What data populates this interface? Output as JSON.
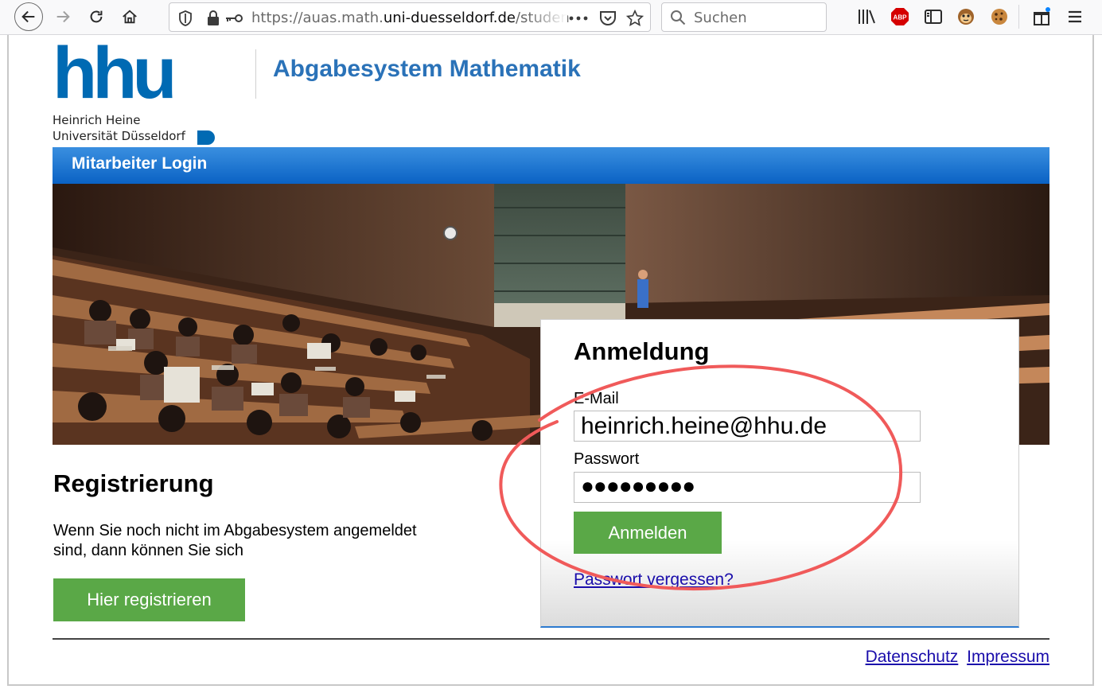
{
  "browser": {
    "url_prefix": "https://auas.math.",
    "url_domain": "uni-duesseldorf.de",
    "url_path": "/studen",
    "search_placeholder": "Suchen",
    "adblock_badge": "ABP"
  },
  "header": {
    "logo_text": "hhu",
    "logo_line1": "Heinrich Heine",
    "logo_line2": "Universität Düsseldorf",
    "site_title": "Abgabesystem Mathematik"
  },
  "nav": {
    "staff_login": "Mitarbeiter Login"
  },
  "login": {
    "title": "Anmeldung",
    "email_label": "E-Mail",
    "email_value": "heinrich.heine@hhu.de",
    "password_label": "Passwort",
    "password_value": "●●●●●●●●●",
    "submit_label": "Anmelden",
    "forgot_link": "Passwort vergessen?"
  },
  "registration": {
    "title": "Registrierung",
    "text": "Wenn Sie noch nicht im Abgabesystem angemeldet sind, dann können Sie sich",
    "button_label": "Hier registrieren"
  },
  "footer": {
    "privacy": "Datenschutz",
    "imprint": "Impressum"
  },
  "colors": {
    "brand_blue": "#006ab3",
    "title_blue": "#2a72b8",
    "button_green": "#5aa847",
    "annotation_red": "#f05a5a",
    "link_color": "#1a0dab"
  }
}
